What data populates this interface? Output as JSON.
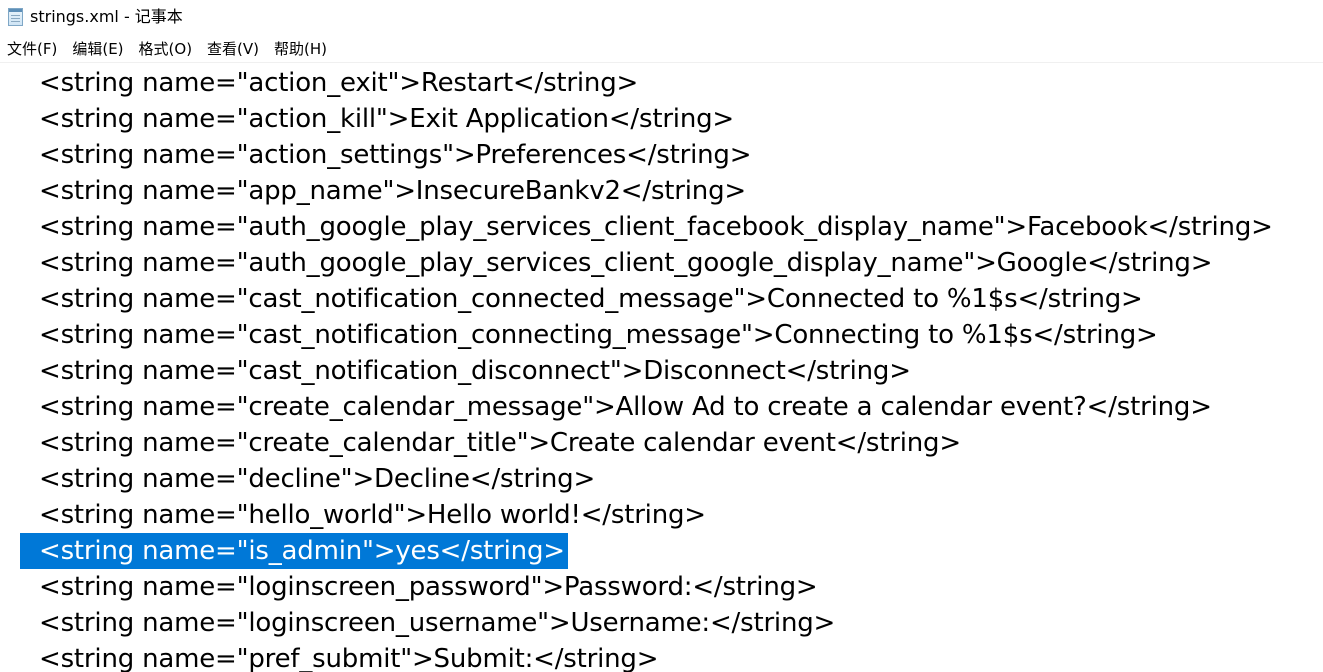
{
  "window": {
    "title": "strings.xml - 记事本"
  },
  "menu": [
    {
      "label": "文件(F)",
      "name": "menu-file"
    },
    {
      "label": "编辑(E)",
      "name": "menu-edit"
    },
    {
      "label": "格式(O)",
      "name": "menu-format"
    },
    {
      "label": "查看(V)",
      "name": "menu-view"
    },
    {
      "label": "帮助(H)",
      "name": "menu-help"
    }
  ],
  "editor": {
    "lines": [
      "<string name=\"action_exit\">Restart</string>",
      "<string name=\"action_kill\">Exit Application</string>",
      "<string name=\"action_settings\">Preferences</string>",
      "<string name=\"app_name\">InsecureBankv2</string>",
      "<string name=\"auth_google_play_services_client_facebook_display_name\">Facebook</string>",
      "<string name=\"auth_google_play_services_client_google_display_name\">Google</string>",
      "<string name=\"cast_notification_connected_message\">Connected to %1$s</string>",
      "<string name=\"cast_notification_connecting_message\">Connecting to %1$s</string>",
      "<string name=\"cast_notification_disconnect\">Disconnect</string>",
      "<string name=\"create_calendar_message\">Allow Ad to create a calendar event?</string>",
      "<string name=\"create_calendar_title\">Create calendar event</string>",
      "<string name=\"decline\">Decline</string>",
      "<string name=\"hello_world\">Hello world!</string>",
      "<string name=\"is_admin\">yes</string>",
      "<string name=\"loginscreen_password\">Password:</string>",
      "<string name=\"loginscreen_username\">Username:</string>",
      "<string name=\"pref_submit\">Submit:</string>"
    ],
    "selected_line": 14,
    "selection_color": "#0078d7"
  },
  "icons": {
    "app": "notepad-icon"
  }
}
